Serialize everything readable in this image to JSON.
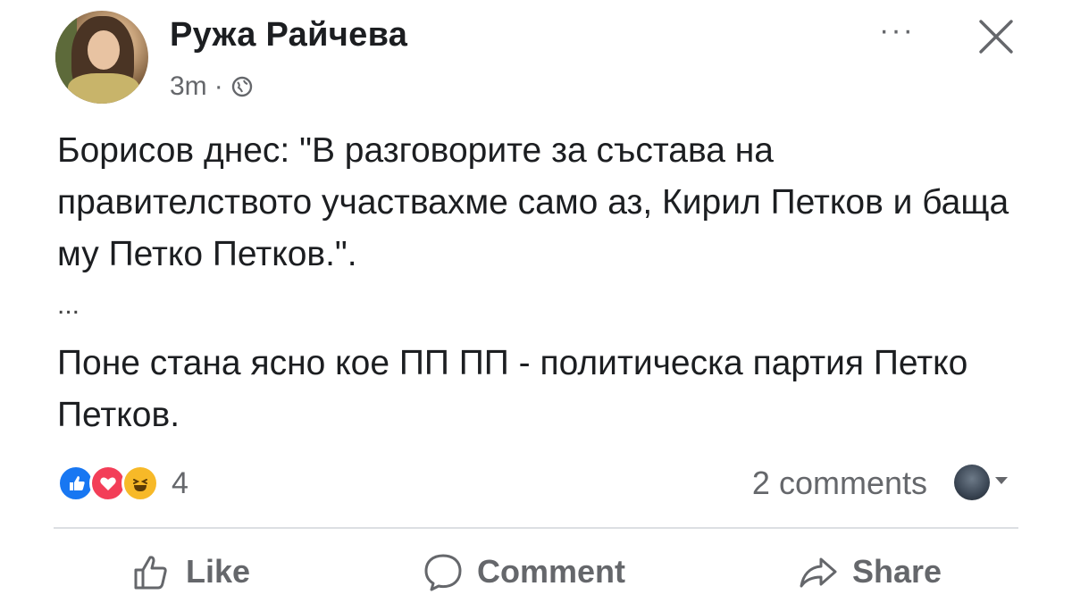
{
  "post": {
    "author": "Ружа Райчева",
    "time": "3m",
    "meta_separator": "·",
    "visibility_icon": "globe-icon",
    "more_label": "···",
    "close_icon": "close-icon",
    "paragraphs": [
      "Борисов днес: \"В разговорите за състава на правителството участвахме само аз, Кирил Петков и баща му Петко Петков.\".",
      "...",
      "Поне стана ясно кое ПП ПП - политическа партия Петко Петков."
    ]
  },
  "engagement": {
    "reactions": [
      "like",
      "love",
      "haha"
    ],
    "reaction_count": "4",
    "comments": "2 comments"
  },
  "actions": {
    "like": "Like",
    "comment": "Comment",
    "share": "Share"
  },
  "colors": {
    "like_blue": "#1877f2",
    "love_red": "#f33e58",
    "haha_yellow": "#f7b928",
    "secondary_text": "#65676b"
  }
}
